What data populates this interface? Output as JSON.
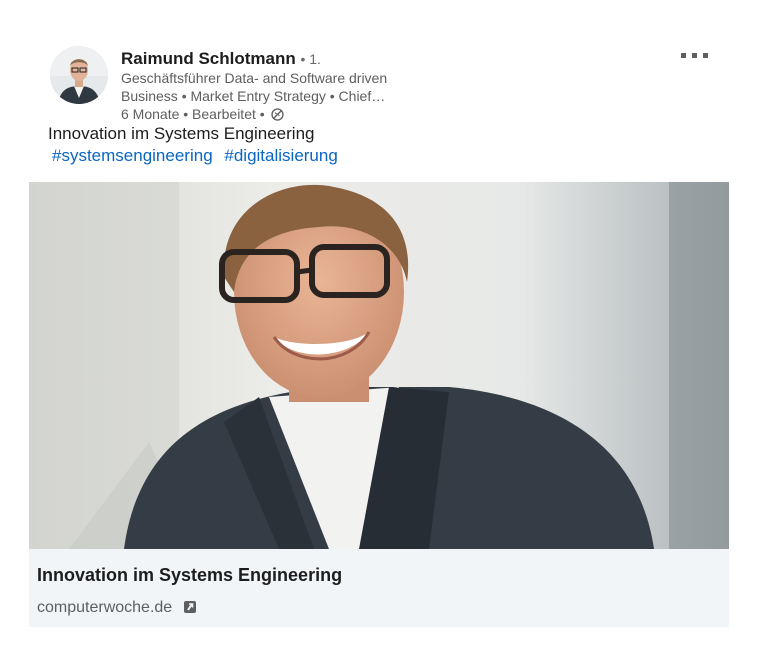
{
  "post": {
    "author_name": "Raimund Schlotmann",
    "degree": "• 1.",
    "headline": "Geschäftsführer Data- and Software driven Business • Market Entry Strategy • Chief…",
    "meta": "6 Monate • Bearbeitet •",
    "text": "Innovation im Systems Engineering",
    "hashtags": [
      "#systemsengineering",
      "#digitalisierung"
    ],
    "visibility_icon": "globe-icon",
    "more_icon": "more-options-icon"
  },
  "link_card": {
    "title": "Innovation im Systems Engineering",
    "domain": "computerwoche.de",
    "external_icon": "external-link-icon"
  },
  "colors": {
    "link": "#0a66c2",
    "card_footer": "#f2f5f8",
    "meta_text": "#5e5e5e"
  }
}
